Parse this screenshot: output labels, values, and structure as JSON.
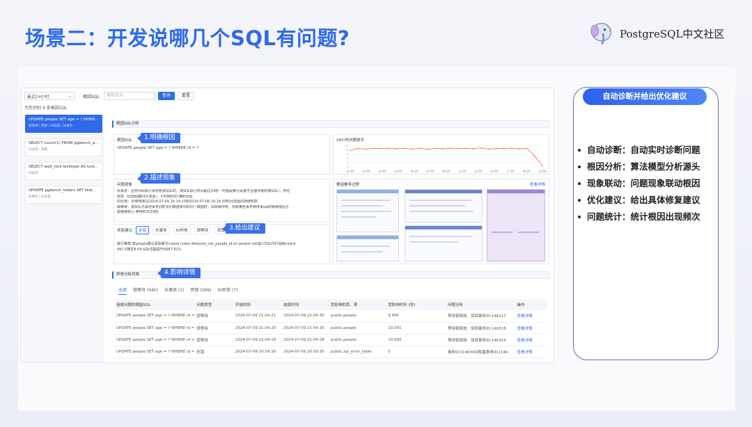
{
  "slide": {
    "title": "场景二：开发说哪几个SQL有问题?",
    "logo_text": "PostgreSQL中文社区"
  },
  "toolbar": {
    "time_select": "最近24小时",
    "root_sql_label": "根因SQL:",
    "search_placeholder": "模糊查询",
    "query_button": "查询",
    "reset_button": "重置",
    "found_text": "为您识别 4 条根因SQL"
  },
  "sql_list": [
    {
      "sql": "UPDATE people SET age = ? WHER...",
      "tags": "锁等待 \\ 死锁 \\ IO异常 \\ 长事务"
    },
    {
      "sql": "SELECT count(1) FROM pgbench_a...",
      "tags": "IO异常 \\ 死锁"
    },
    {
      "sql": "SELECT wait_lock.locktype AS lock...",
      "tags": "IO异常"
    },
    {
      "sql": "UPDATE pgbench_tellers SET tbal...",
      "tags": "长事务 \\ IO异常"
    }
  ],
  "analysis": {
    "section_title": "根因SQL分析",
    "root_sql_title": "根因SQL",
    "root_sql_text": "UPDATE people SET age = ? WHERE id = ?",
    "freq_title": "24小时问题频次",
    "phenomenon_title": "问题现象",
    "phenomenon_lines": [
      "长事务：业务代码执行事务到该SQL时，该SQL执行时间超过14秒（可能是索引设置不合理导致的慢SQL），存在",
      "较高（比如阻塞DDL变更），CPU和IO打满的风险",
      "IO异常：IO使用率在2024-07-09 14:14:10到2024-07-09 14:16:30时间范围内持续较高",
      "锁等待：该SQL与其他事务同时访问数据库中的同一数据时，出现锁冲突，导致某些事务等待该sql的锁释放后才",
      "能继续执行,等待时长达8秒"
    ],
    "recommend_title": "根因推导过程",
    "view_detail": "查看详情",
    "fix_title": "修复建议",
    "fix_tabs": [
      "全部",
      "长事务",
      "IO异常",
      "锁等待",
      "死锁"
    ],
    "fix_text_1": "索引推荐:表people建议添加索引create index dbdoctor_idx_people_id on people (id)减少SQL代价消耗cost从",
    "fix_text_2": "497.5降至8.04,SQL性能提升6087.81%"
  },
  "chart_data": {
    "type": "line",
    "categories": [
      "21:00",
      "23:00",
      "01:00",
      "03:00",
      "05:00",
      "07:00",
      "09:00",
      "11:00",
      "13:00",
      "15:00",
      "17:00",
      "19:00",
      "21:00"
    ],
    "values": [
      7.5,
      8.6,
      8.3,
      8.6,
      8.5,
      8.7,
      8.4,
      8.6,
      8.3,
      8.7,
      8.2,
      8.6,
      8.4,
      8.7,
      8.5,
      8.6,
      8.4,
      8.8,
      8.3,
      8.6,
      8.5,
      8.7,
      8.4,
      8.6,
      5.0,
      0.5
    ],
    "ylim": [
      0,
      10
    ],
    "yticks": [
      "10",
      "8",
      "6",
      "4",
      "2",
      "0"
    ],
    "title": "24小时问题频次"
  },
  "callouts": {
    "c1": "1.明确根因",
    "c2": "2.描述现象",
    "c3": "3.给出建议",
    "c4": "4.影响详情"
  },
  "anomaly": {
    "section_title": "异常分析列表",
    "tabs": [
      "全部",
      "锁等待 (940)",
      "长事务 (1)",
      "死锁 (266)",
      "IO异常 (7)"
    ],
    "columns": [
      "造成问题的根因SQL",
      "问题类型",
      "开始时间",
      "结束时间",
      "受影响的库、表",
      "受影响时长 (秒)",
      "问题分析",
      "操作"
    ],
    "rows": [
      [
        "UPDATE people SET age = ? WHERE id =",
        "锁等待",
        "2024-07-09 21:04:21",
        "2024-07-09 21:04:30",
        "public.people",
        "9.995",
        "等待锁释放、加锁事务ID:146317",
        "查看详情"
      ],
      [
        "UPDATE people SET age = ? WHERE id =",
        "锁等待",
        "2024-07-09 21:04:20",
        "2024-07-09 21:04:30",
        "public.people",
        "10.001",
        "等待锁释放、加锁事务ID:146318",
        "查看详情"
      ],
      [
        "UPDATE people SET age = ? WHERE id =",
        "锁等待",
        "2024-07-09 21:04:18",
        "2024-07-09 21:04:28",
        "public.people",
        "10.005",
        "等待锁释放、加锁事务ID:146319",
        "查看详情"
      ],
      [
        "UPDATE people SET age = ? WHERE id =",
        "死锁",
        "2024-07-09 20:59:30",
        "2024-07-09 20:59:30",
        "public.sql_error_table",
        "0",
        "事务ID:[146309]阻塞事务ID:[146:",
        "查看详情"
      ]
    ]
  },
  "right_panel": {
    "header": "自动诊断并给出优化建议",
    "bullets": [
      "自动诊断：自动实时诊断问题",
      "根因分析：算法模型分析源头",
      "现象联动：问题现象联动根因",
      "优化建议：给出具体修复建议",
      "问题统计：统计根因出现频次"
    ]
  }
}
